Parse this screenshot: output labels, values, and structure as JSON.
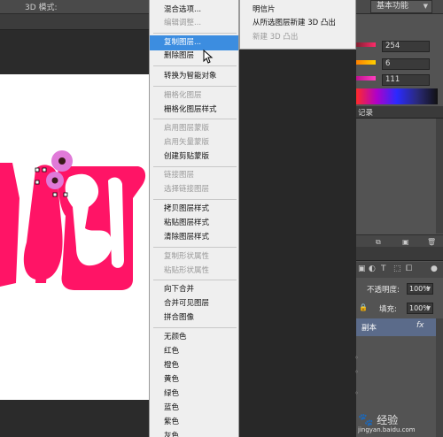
{
  "option_bar": {
    "mode_label": "3D 模式:",
    "workspace": "基本功能"
  },
  "context_menu": {
    "items": [
      {
        "label": "混合选项...",
        "enabled": true
      },
      {
        "label": "编辑调整...",
        "enabled": false
      },
      {
        "label": "复制图层...",
        "enabled": true,
        "highlighted": true
      },
      {
        "label": "删除图层",
        "enabled": true
      },
      {
        "label": "转换为智能对象",
        "enabled": true
      },
      {
        "label": "栅格化图层",
        "enabled": false
      },
      {
        "label": "栅格化图层样式",
        "enabled": true
      },
      {
        "label": "启用图层蒙版",
        "enabled": false
      },
      {
        "label": "启用矢量蒙版",
        "enabled": false
      },
      {
        "label": "创建剪贴蒙版",
        "enabled": true
      },
      {
        "label": "链接图层",
        "enabled": false
      },
      {
        "label": "选择链接图层",
        "enabled": false
      },
      {
        "label": "拷贝图层样式",
        "enabled": true
      },
      {
        "label": "粘贴图层样式",
        "enabled": true
      },
      {
        "label": "清除图层样式",
        "enabled": true
      },
      {
        "label": "复制形状属性",
        "enabled": false
      },
      {
        "label": "粘贴形状属性",
        "enabled": false
      },
      {
        "label": "向下合并",
        "enabled": true
      },
      {
        "label": "合并可见图层",
        "enabled": true
      },
      {
        "label": "拼合图像",
        "enabled": true
      },
      {
        "label": "无颜色",
        "enabled": true
      },
      {
        "label": "红色",
        "enabled": true
      },
      {
        "label": "橙色",
        "enabled": true
      },
      {
        "label": "黄色",
        "enabled": true
      },
      {
        "label": "绿色",
        "enabled": true
      },
      {
        "label": "蓝色",
        "enabled": true
      },
      {
        "label": "紫色",
        "enabled": true
      },
      {
        "label": "灰色",
        "enabled": true
      }
    ]
  },
  "submenu": {
    "items": [
      {
        "label": "明信片",
        "enabled": true
      },
      {
        "label": "从所选图层新建 3D 凸出",
        "enabled": true
      },
      {
        "label": "新建 3D 凸出",
        "enabled": false
      }
    ]
  },
  "color_panel": {
    "values": [
      "254",
      "6",
      "111"
    ],
    "colors": [
      "#ff2a6a",
      "#ffd000",
      "#ff40c0"
    ]
  },
  "history_panel": {
    "tab": "记录"
  },
  "layers_panel": {
    "opacity_label": "不透明度:",
    "opacity_value": "100%",
    "fill_label": "填充:",
    "fill_value": "100%",
    "layer_name": "副本",
    "fx_label": "fx"
  },
  "watermark": {
    "text": "经验",
    "url": "jingyan.baidu.com"
  },
  "canvas": {
    "accent_color": "#ff1466"
  }
}
